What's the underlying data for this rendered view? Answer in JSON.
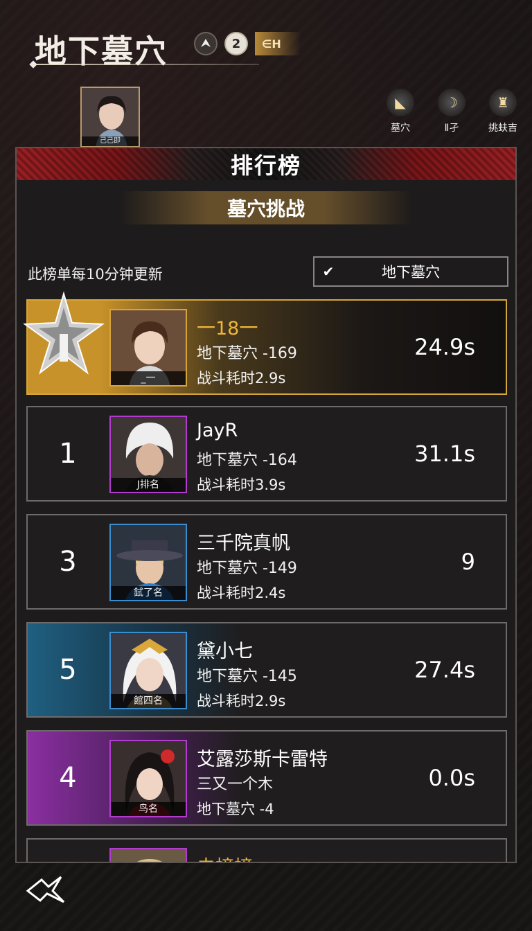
{
  "header": {
    "title": "地下墓穴",
    "badge_num": "2",
    "badge_text": "∈H"
  },
  "player": {
    "label": "己己即"
  },
  "nav": [
    {
      "label": "墓穴",
      "icon": "spirit-icon"
    },
    {
      "label": "Ⅱ孑",
      "icon": "crescent-icon"
    },
    {
      "label": "挑蚨吉",
      "icon": "figure-icon"
    }
  ],
  "panel": {
    "title": "排行榜",
    "subtitle": "墓穴挑战",
    "notice": "此榜单每10分钟更新",
    "select_value": "地下墓穴"
  },
  "rows": [
    {
      "rank": "",
      "avatar_caption": "_一",
      "name": "一18一",
      "line2": "地下墓穴 -169",
      "line3": "战斗耗时2.9s",
      "score": "24.9s"
    },
    {
      "rank": "1",
      "avatar_caption": "J排名",
      "name": "JayR",
      "line2": "地下墓穴 -164",
      "line3": "战斗耗时3.9s",
      "score": "31.1s"
    },
    {
      "rank": "3",
      "avatar_caption": "鉽了名",
      "name": "三千院真帆",
      "line2": "地下墓穴 -149",
      "line3": "战斗耗时2.4s",
      "score": "9"
    },
    {
      "rank": "5",
      "avatar_caption": "館四名",
      "name": "黛小七",
      "line2": "地下墓穴 -145",
      "line3": "战斗耗时2.9s",
      "score": "27.4s"
    },
    {
      "rank": "4",
      "avatar_caption": "鸟名",
      "name": "艾露莎斯卡雷特",
      "line2": "三又一个木",
      "line3": "地下墓穴 -4",
      "score": "0.0s"
    }
  ],
  "partial_row_name": "未榜榜",
  "colors": {
    "gold": "#d6a53a",
    "purple": "#b43ad0",
    "blue": "#3a8ed0",
    "red": "#9a1f22"
  }
}
